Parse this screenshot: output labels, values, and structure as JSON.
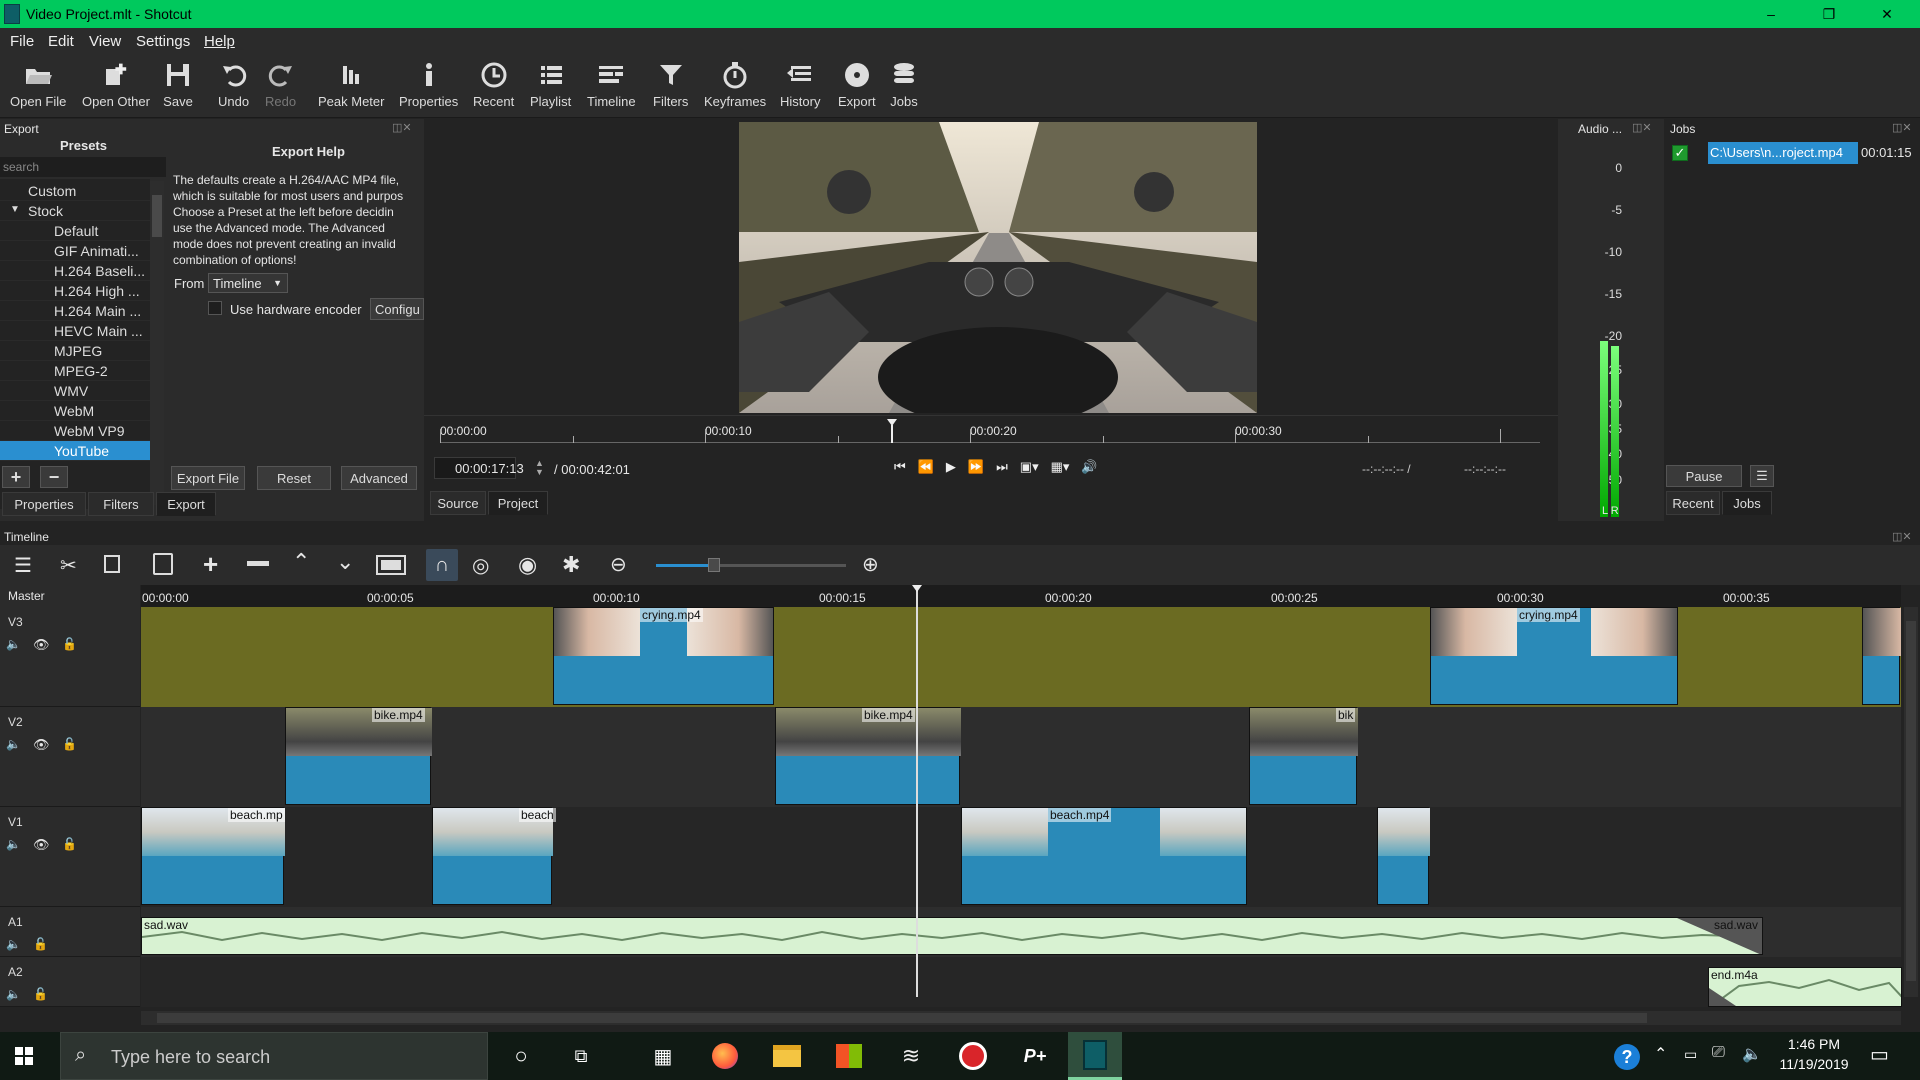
{
  "window": {
    "title": "Video Project.mlt - Shotcut",
    "minimize": "–",
    "restore": "❐",
    "close": "✕"
  },
  "menu": [
    "File",
    "Edit",
    "View",
    "Settings",
    "Help"
  ],
  "toolbar": [
    {
      "label": "Open File",
      "icon": "folder-open-icon"
    },
    {
      "label": "Open Other",
      "icon": "open-other-icon"
    },
    {
      "label": "Save",
      "icon": "save-icon"
    },
    {
      "label": "Undo",
      "icon": "undo-icon"
    },
    {
      "label": "Redo",
      "icon": "redo-icon"
    },
    {
      "label": "Peak Meter",
      "icon": "peak-meter-icon"
    },
    {
      "label": "Properties",
      "icon": "info-icon"
    },
    {
      "label": "Recent",
      "icon": "clock-icon"
    },
    {
      "label": "Playlist",
      "icon": "playlist-icon"
    },
    {
      "label": "Timeline",
      "icon": "timeline-icon"
    },
    {
      "label": "Filters",
      "icon": "filter-icon"
    },
    {
      "label": "Keyframes",
      "icon": "stopwatch-icon"
    },
    {
      "label": "History",
      "icon": "history-icon"
    },
    {
      "label": "Export",
      "icon": "export-disc-icon"
    },
    {
      "label": "Jobs",
      "icon": "jobs-stack-icon"
    }
  ],
  "export": {
    "panel_title": "Export",
    "presets_header": "Presets",
    "search_placeholder": "search",
    "presets": [
      "Custom",
      "Stock",
      "Default",
      "GIF Animati...",
      "H.264 Baseli...",
      "H.264 High ...",
      "H.264 Main ...",
      "HEVC Main ...",
      "MJPEG",
      "MPEG-2",
      "WMV",
      "WebM",
      "WebM VP9",
      "YouTube"
    ],
    "help_title": "Export Help",
    "help_lines": [
      "The defaults create a H.264/AAC MP4 file,",
      "which is suitable for most users and purpos",
      "Choose a Preset at the left before decidin",
      "use the Advanced mode. The Advanced",
      "mode does not prevent creating an invalid",
      "combination of options!"
    ],
    "from_label": "From",
    "from_value": "Timeline",
    "hw_encoder": "Use hardware encoder",
    "configure": "Configu",
    "export_file": "Export File",
    "reset": "Reset",
    "advanced": "Advanced",
    "add": "+",
    "remove": "−"
  },
  "left_tabs": [
    "Properties",
    "Filters",
    "Export"
  ],
  "player": {
    "ruler": [
      "00:00:00",
      "00:00:10",
      "00:00:20",
      "00:00:30"
    ],
    "position": "00:00:17:13",
    "duration": "/ 00:00:42:01",
    "in_out": "--:--:--:-- /",
    "out": "--:--:--:--",
    "tabs": [
      "Source",
      "Project"
    ]
  },
  "audio": {
    "title": "Audio ...",
    "scale": [
      "0",
      "-5",
      "-10",
      "-15",
      "-20",
      "-25",
      "-30",
      "-35",
      "-40",
      "-50"
    ],
    "lr": "L R",
    "level_left": 0.72,
    "level_right": 0.7
  },
  "jobs": {
    "title": "Jobs",
    "job_name": "C:\\Users\\n...roject.mp4",
    "job_time": "00:01:15",
    "pause": "Pause",
    "tabs": [
      "Recent",
      "Jobs"
    ]
  },
  "timeline": {
    "title": "Timeline",
    "master": "Master",
    "ruler": [
      "00:00:00",
      "00:00:05",
      "00:00:10",
      "00:00:15",
      "00:00:20",
      "00:00:25",
      "00:00:30",
      "00:00:35"
    ],
    "tracks": [
      "V3",
      "V2",
      "V1",
      "A1",
      "A2"
    ],
    "clips": {
      "crying1": "crying.mp4",
      "crying2": "crying.mp4",
      "bike1": "bike.mp4",
      "bike2": "bike.mp4",
      "bike3": "bik",
      "beach1": "beach.mp",
      "beach2": "beach",
      "beach3": "beach.mp4",
      "sad1": "sad.wav",
      "sad2": "sad.wav",
      "end": "end.m4a"
    }
  },
  "taskbar": {
    "search_placeholder": "Type here to search",
    "time": "1:46 PM",
    "date": "11/19/2019"
  },
  "colors": {
    "titlebar": "#00c95d",
    "accent": "#2a8fd0",
    "clip": "#2a8ab8",
    "track_selected": "#6b6b22",
    "audio": "#d8f2d2"
  }
}
